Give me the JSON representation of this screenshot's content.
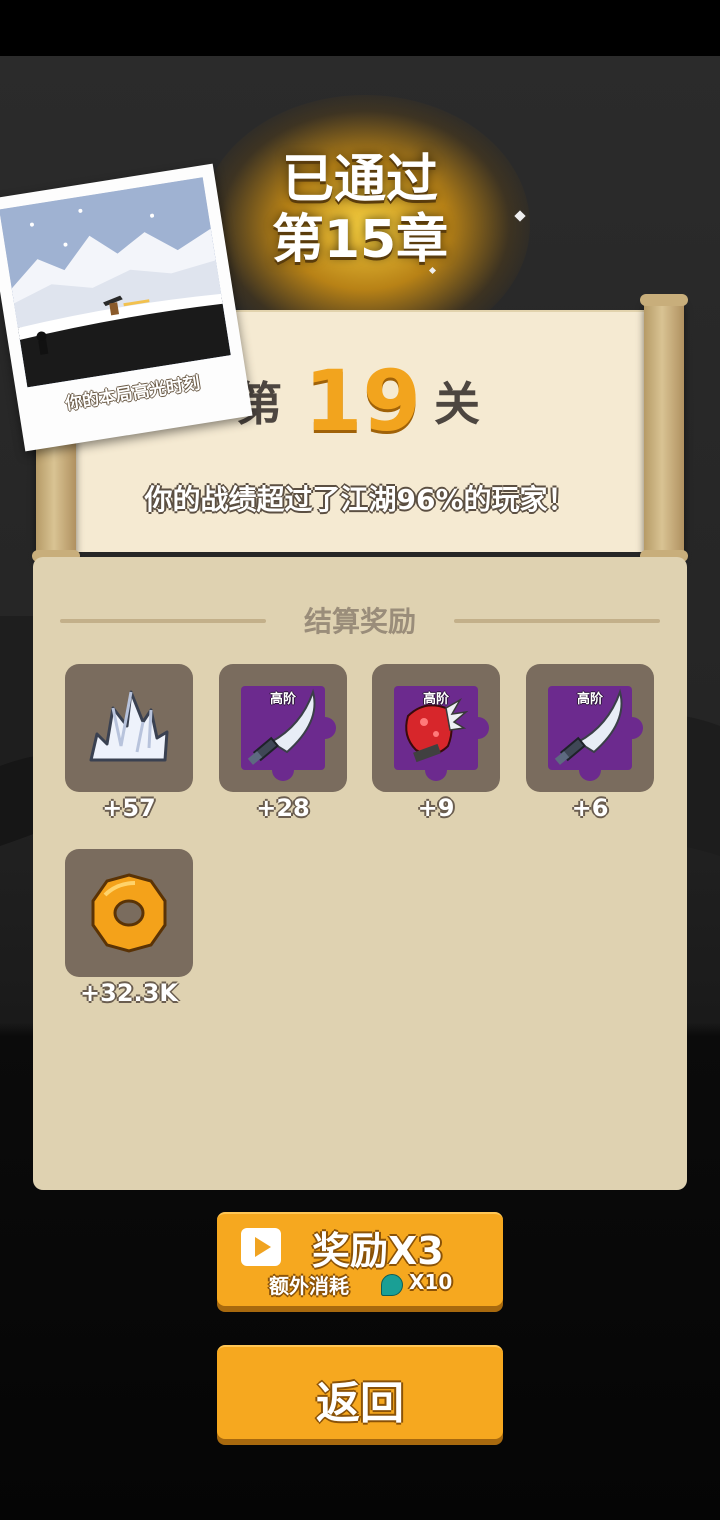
{
  "result": {
    "passed_text": "已通过",
    "chapter_text": "第15章"
  },
  "level": {
    "prefix": "第",
    "number": "19",
    "suffix": "关",
    "rank_text": "你的战绩超过了江湖96%的玩家！"
  },
  "highlight": {
    "caption": "你的本局高光时刻"
  },
  "rewards": {
    "title": "结算奖励",
    "items": [
      {
        "icon": "ice-crystal-icon",
        "count": "+57"
      },
      {
        "icon": "saber-fragment-icon",
        "tier": "高阶",
        "count": "+28"
      },
      {
        "icon": "spiked-gauntlet-fragment-icon",
        "tier": "高阶",
        "count": "+9"
      },
      {
        "icon": "saber-fragment-icon",
        "tier": "高阶",
        "count": "+6"
      },
      {
        "icon": "copper-coin-icon",
        "count": "+32.3K"
      }
    ]
  },
  "buttons": {
    "ad_reward_label": "奖励X3",
    "ad_cost_prefix": "额外消耗",
    "ad_cost_amount": "X10",
    "back_label": "返回"
  },
  "colors": {
    "button_orange": "#f6a81f",
    "level_number": "#f2a41e",
    "panel": "#dfd2b1",
    "scroll_paper": "#f5ead2",
    "fragment_purple": "#6c2a8e"
  }
}
